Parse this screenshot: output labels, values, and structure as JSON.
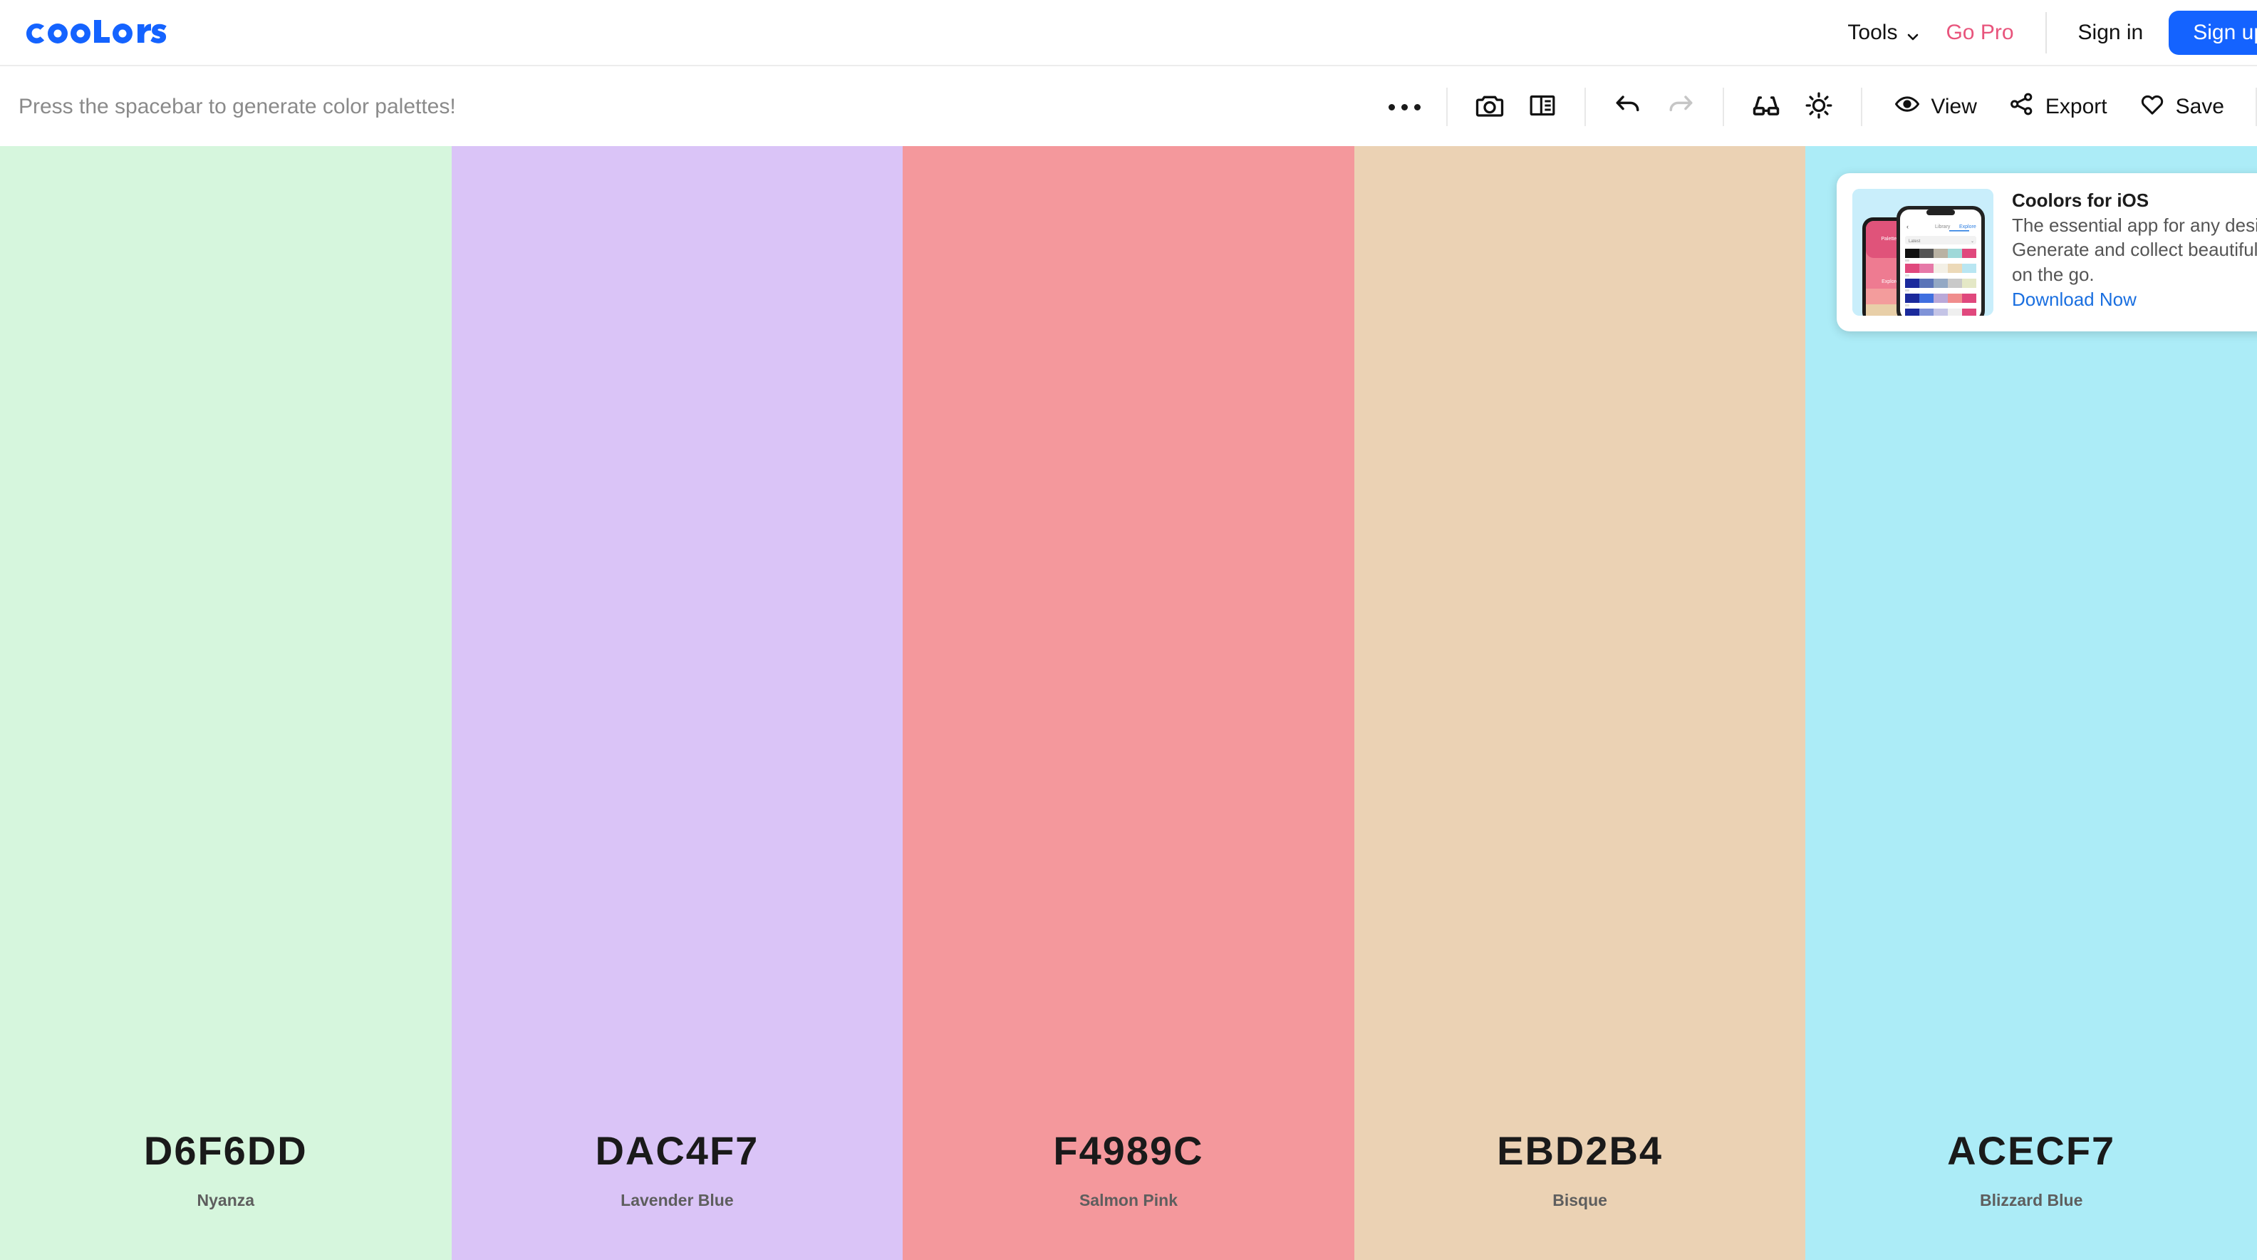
{
  "brand": {
    "logo_text": "coolors",
    "logo_color": "#1463ff"
  },
  "nav": {
    "tools_label": "Tools",
    "tools_icon": "chevron-down-icon",
    "go_pro_label": "Go Pro",
    "go_pro_color": "#e8547c",
    "sign_in_label": "Sign in",
    "sign_up_label": "Sign up",
    "sign_up_color": "#1463ff"
  },
  "toolbar": {
    "hint": "Press the spacebar to generate color palettes!",
    "more_icon": "more-horizontal-icon",
    "camera_icon": "camera-icon",
    "layout_icon": "layout-panel-icon",
    "undo_icon": "undo-icon",
    "redo_icon": "redo-icon",
    "redo_disabled": true,
    "glasses_icon": "glasses-icon",
    "brightness_icon": "sun-icon",
    "view_label": "View",
    "view_icon": "eye-icon",
    "export_label": "Export",
    "export_icon": "share-icon",
    "save_label": "Save",
    "save_icon": "heart-icon"
  },
  "palette": {
    "swatches": [
      {
        "hex": "D6F6DD",
        "color": "#D6F6DD",
        "name": "Nyanza"
      },
      {
        "hex": "DAC4F7",
        "color": "#DAC4F7",
        "name": "Lavender Blue"
      },
      {
        "hex": "F4989C",
        "color": "#F4989C",
        "name": "Salmon Pink"
      },
      {
        "hex": "EBD2B4",
        "color": "#EBD2B4",
        "name": "Bisque"
      },
      {
        "hex": "ACECF7",
        "color": "#ACECF7",
        "name": "Blizzard Blue"
      }
    ]
  },
  "ad": {
    "title": "Coolors for iOS",
    "description": "The essential app for any designer. Generate and collect beautiful color palettes on the go.",
    "link_label": "Download Now",
    "link_color": "#1a6fe0",
    "thumb_icon": "iphone-app-screenshot",
    "close_icon": "ad-options-icon"
  }
}
